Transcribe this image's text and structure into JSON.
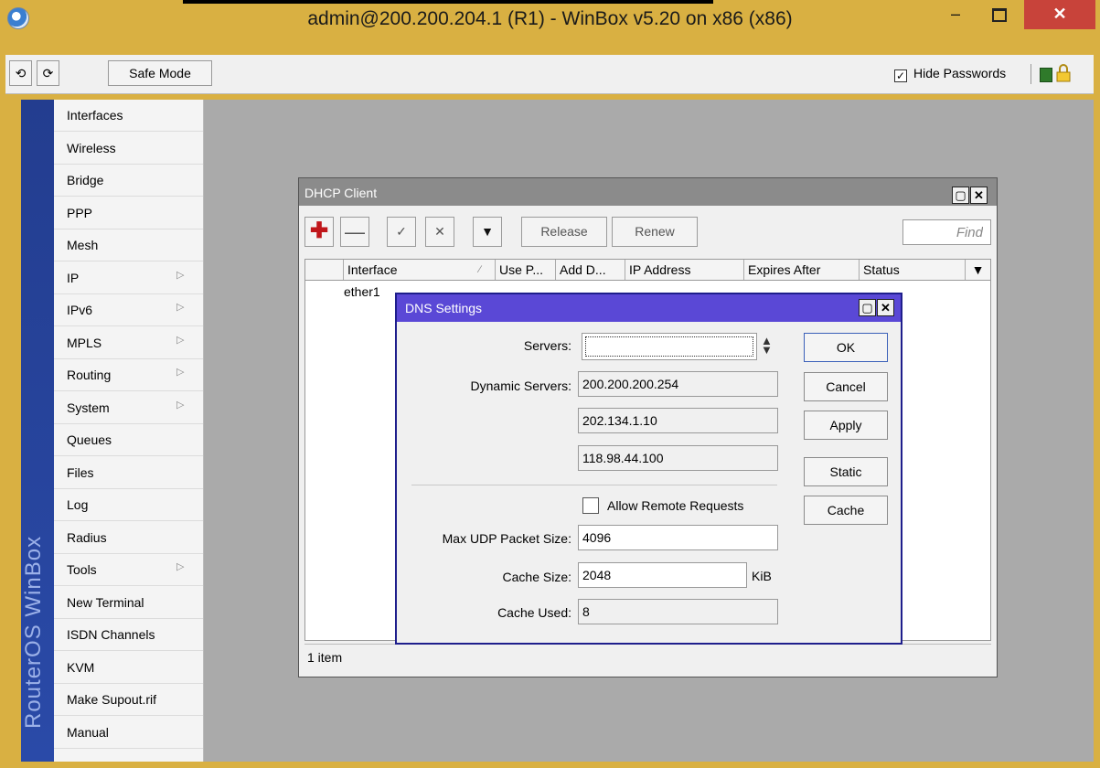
{
  "window": {
    "title": "admin@200.200.204.1 (R1) - WinBox v5.20 on x86 (x86)",
    "minimize_glyph": "–",
    "close_glyph": "✕"
  },
  "toolbar": {
    "undo_glyph": "⟲",
    "redo_glyph": "⟳",
    "safe_mode_label": "Safe Mode",
    "hide_passwords_label": "Hide Passwords",
    "hide_passwords_checked": true
  },
  "sidebar": {
    "brand": "RouterOS WinBox",
    "items": [
      {
        "label": "Interfaces",
        "submenu": false
      },
      {
        "label": "Wireless",
        "submenu": false
      },
      {
        "label": "Bridge",
        "submenu": false
      },
      {
        "label": "PPP",
        "submenu": false
      },
      {
        "label": "Mesh",
        "submenu": false
      },
      {
        "label": "IP",
        "submenu": true
      },
      {
        "label": "IPv6",
        "submenu": true
      },
      {
        "label": "MPLS",
        "submenu": true
      },
      {
        "label": "Routing",
        "submenu": true
      },
      {
        "label": "System",
        "submenu": true
      },
      {
        "label": "Queues",
        "submenu": false
      },
      {
        "label": "Files",
        "submenu": false
      },
      {
        "label": "Log",
        "submenu": false
      },
      {
        "label": "Radius",
        "submenu": false
      },
      {
        "label": "Tools",
        "submenu": true
      },
      {
        "label": "New Terminal",
        "submenu": false
      },
      {
        "label": "ISDN Channels",
        "submenu": false
      },
      {
        "label": "KVM",
        "submenu": false
      },
      {
        "label": "Make Supout.rif",
        "submenu": false
      },
      {
        "label": "Manual",
        "submenu": false
      }
    ]
  },
  "dhcp_client": {
    "title": "DHCP Client",
    "add_glyph": "✚",
    "remove_glyph": "—",
    "enable_glyph": "✓",
    "disable_glyph": "✕",
    "filter_glyph": "▼",
    "release_label": "Release",
    "renew_label": "Renew",
    "find_placeholder": "Find",
    "columns": [
      "Interface",
      "Use P...",
      "Add D...",
      "IP Address",
      "Expires After",
      "Status"
    ],
    "rows": [
      {
        "interface": "ether1"
      }
    ],
    "item_count": "1 item"
  },
  "dns_settings": {
    "title": "DNS Settings",
    "servers_label": "Servers:",
    "servers_value": "",
    "dynamic_servers_label": "Dynamic Servers:",
    "dynamic_servers": [
      "200.200.200.254",
      "202.134.1.10",
      "118.98.44.100"
    ],
    "allow_remote_label": "Allow Remote Requests",
    "allow_remote_checked": false,
    "max_udp_label": "Max UDP Packet Size:",
    "max_udp_value": "4096",
    "cache_size_label": "Cache Size:",
    "cache_size_value": "2048",
    "cache_size_unit": "KiB",
    "cache_used_label": "Cache Used:",
    "cache_used_value": "8",
    "buttons": {
      "ok": "OK",
      "cancel": "Cancel",
      "apply": "Apply",
      "static": "Static",
      "cache": "Cache"
    }
  }
}
